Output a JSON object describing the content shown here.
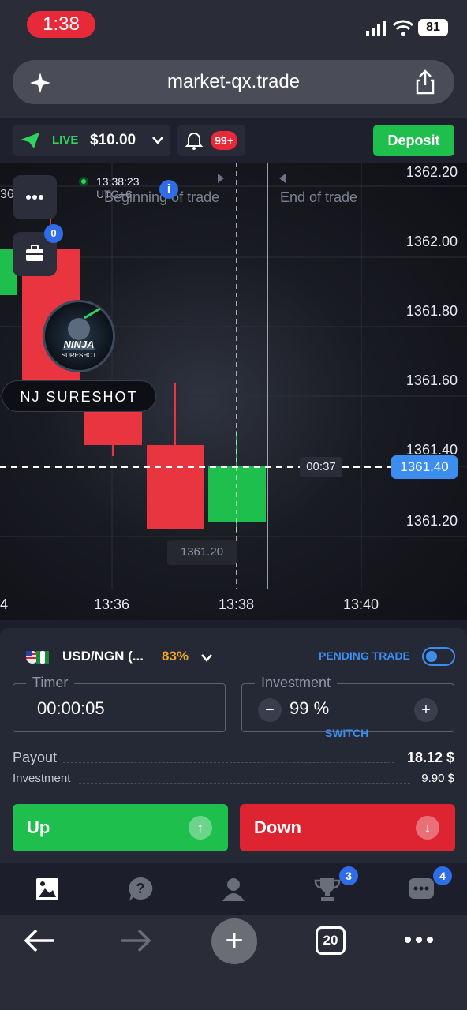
{
  "status_bar": {
    "time": "1:38",
    "battery": "81"
  },
  "browser": {
    "url": "market-qx.trade",
    "tab_count": "20"
  },
  "header": {
    "account_mode": "LIVE",
    "balance": "$10.00",
    "notifications": "99+",
    "deposit_label": "Deposit"
  },
  "chart": {
    "price_ticks": [
      "1362.20",
      "1362.00",
      "1361.80",
      "1361.60",
      "1361.40",
      "1361.20"
    ],
    "time_ticks": [
      "4",
      "13:36",
      "13:38",
      "13:40"
    ],
    "current_price": "1361.40",
    "countdown": "00:37",
    "low_label": "1361.20",
    "clock": "13:38:23",
    "clock_tz": "UTC+6",
    "left_edge_label": "36",
    "beginning_label": "Beginning of trade",
    "end_label": "End of trade",
    "portfolio_count": "0",
    "candles": [
      {
        "dir": "up"
      },
      {
        "dir": "down"
      },
      {
        "dir": "down"
      },
      {
        "dir": "down"
      },
      {
        "dir": "up"
      }
    ],
    "colors": {
      "up": "#1fbf4e",
      "down": "#e8353f",
      "accent": "#3b8df0"
    }
  },
  "watermark": {
    "name": "NJ SURESHOT",
    "logo_text": "NINJA SURESHOT"
  },
  "trade_panel": {
    "asset": "USD/NGN (...",
    "asset_payout_pct": "83%",
    "pending_label": "PENDING TRADE",
    "timer_label": "Timer",
    "timer_value": "00:00:05",
    "investment_label": "Investment",
    "investment_value": "99 %",
    "switch_label": "SWITCH",
    "payout_label": "Payout",
    "payout_value": "18.12 $",
    "investment_row_label": "Investment",
    "investment_row_value": "9.90 $",
    "up_label": "Up",
    "down_label": "Down"
  },
  "app_nav": {
    "trophy_badge": "3",
    "chat_badge": "4"
  }
}
